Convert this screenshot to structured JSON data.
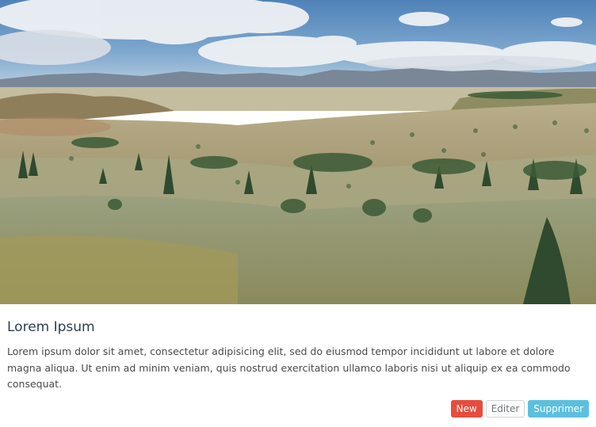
{
  "card": {
    "title": "Lorem Ipsum",
    "text": "Lorem ipsum dolor sit amet, consectetur adipisicing elit, sed do eiusmod tempor incididunt ut labore et dolore magna aliqua. Ut enim ad minim veniam, quis nostrud exercitation ullamco laboris nisi ut aliquip ex ea commodo consequat.",
    "buttons": {
      "new": "New",
      "edit": "Editer",
      "delete": "Supprimer"
    }
  },
  "colors": {
    "title": "#2c3e50",
    "danger": "#e74c3c",
    "info": "#5bc0de"
  }
}
